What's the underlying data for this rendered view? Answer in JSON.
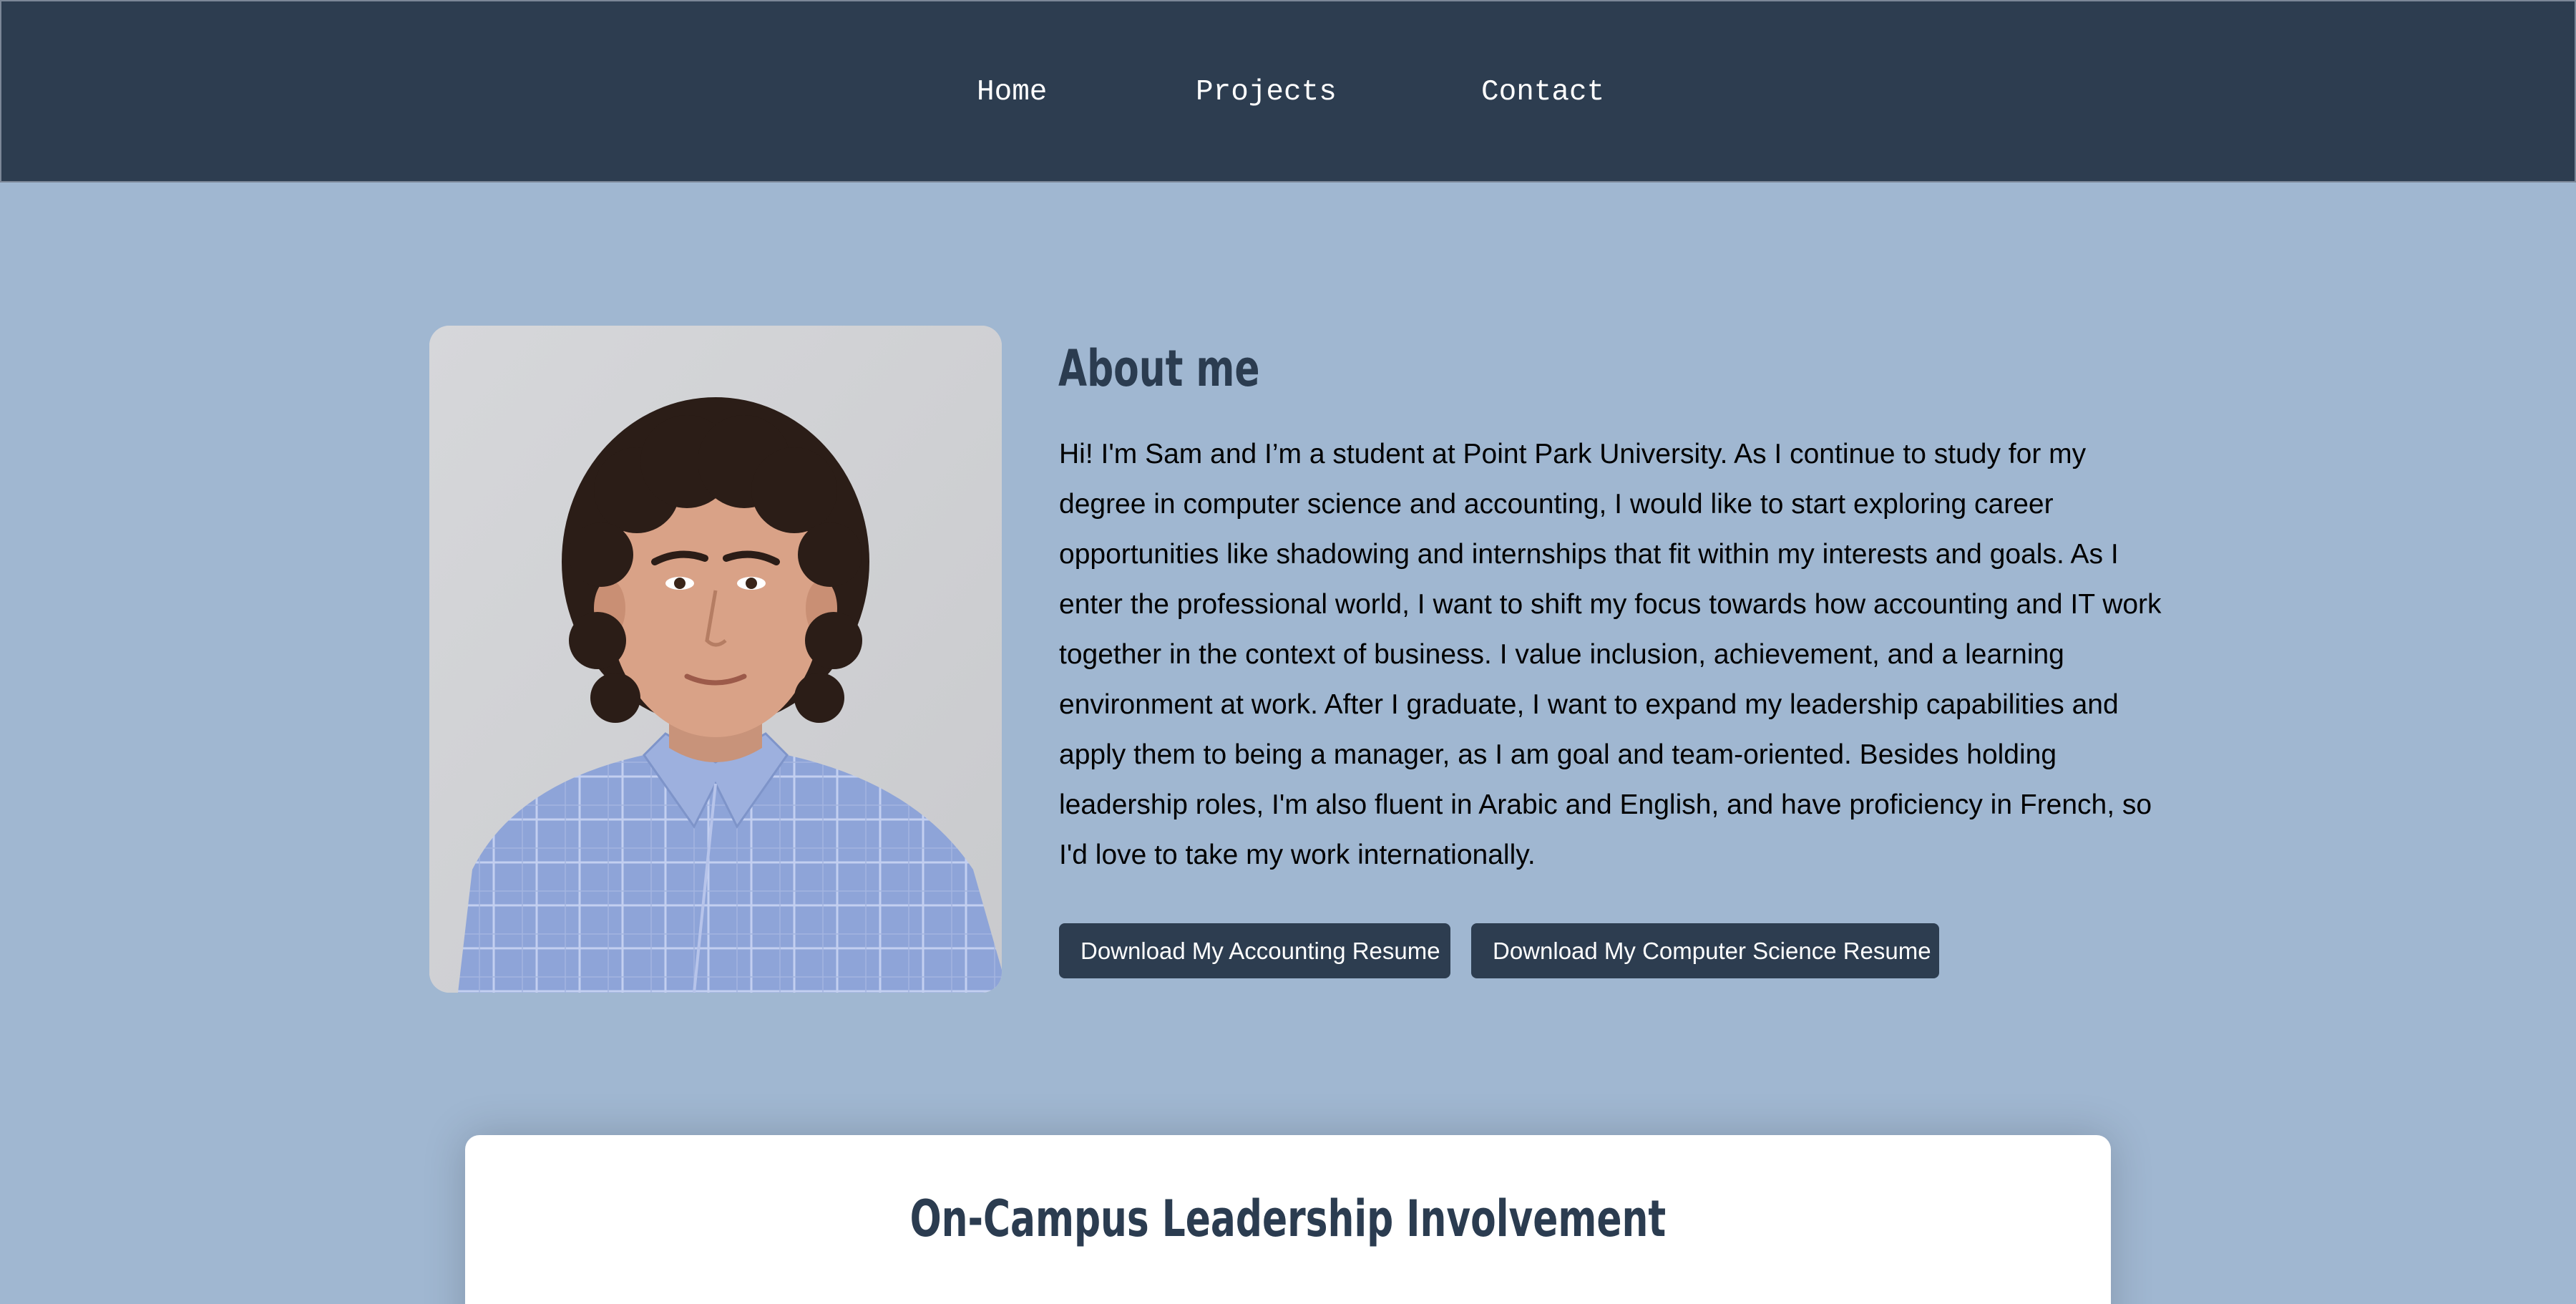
{
  "nav": {
    "home": "Home",
    "projects": "Projects",
    "contact": "Contact"
  },
  "about": {
    "title": "About me",
    "text": "Hi! I'm Sam and I’m a student at Point Park University. As I continue to study for my degree in computer science and accounting, I would like to start exploring career opportunities like shadowing and internships that fit within my interests and goals. As I enter the professional world, I want to shift my focus towards how accounting and IT work together in the context of business. I value inclusion, achievement, and a learning environment at work. After I graduate, I want to expand my leadership capabilities and apply them to being a manager, as I am goal and team-oriented. Besides holding leadership roles, I'm also fluent in Arabic and English, and have proficiency in French, so I'd love to take my work internationally.",
    "buttons": {
      "accounting": "Download My Accounting Resume",
      "cs": "Download My Computer Science Resume"
    }
  },
  "leadership": {
    "title": "On-Campus Leadership Involvement"
  },
  "colors": {
    "nav_bg": "#2d3d50",
    "page_bg": "#a0b7d1",
    "heading": "#2b3c50",
    "button_bg": "#2d3d50"
  }
}
